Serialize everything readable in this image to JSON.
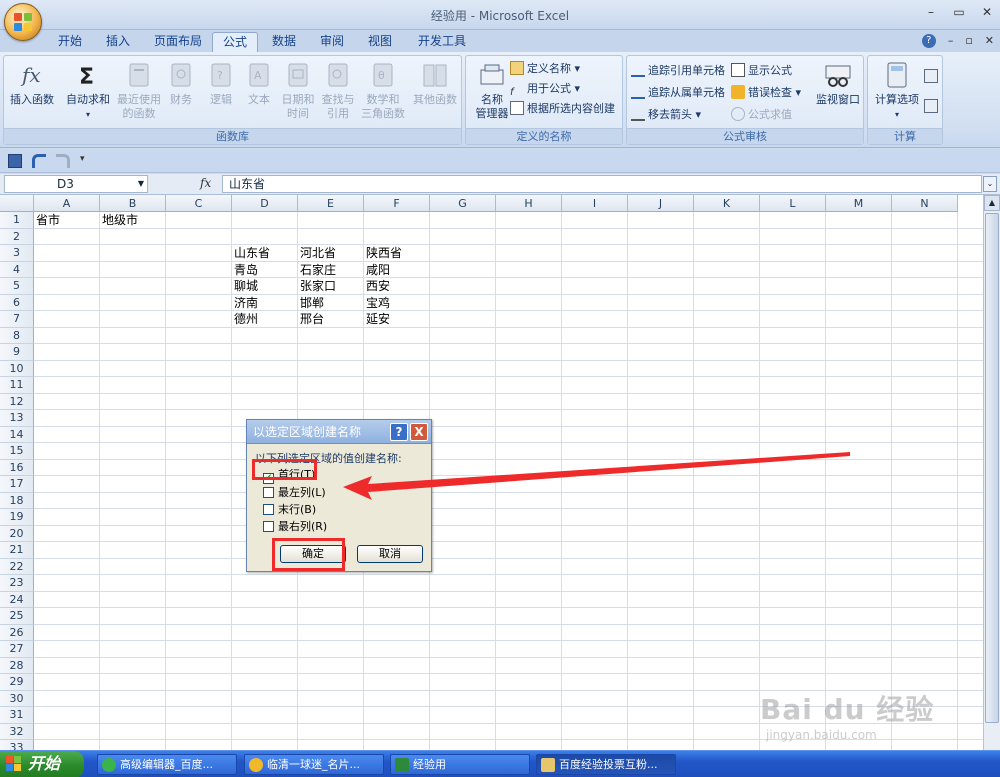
{
  "window": {
    "title": "经验用 - Microsoft Excel"
  },
  "tabs": [
    {
      "label": "开始"
    },
    {
      "label": "插入"
    },
    {
      "label": "页面布局"
    },
    {
      "label": "公式"
    },
    {
      "label": "数据"
    },
    {
      "label": "审阅"
    },
    {
      "label": "视图"
    },
    {
      "label": "开发工具"
    }
  ],
  "active_tab": "公式",
  "ribbon": {
    "library": {
      "label": "函数库",
      "insert_function": "插入函数",
      "autosum": "自动求和",
      "recent_1": "最近使用",
      "recent_2": "的函数",
      "financial": "财务",
      "logical": "逻辑",
      "text": "文本",
      "datetime_1": "日期和",
      "datetime_2": "时间",
      "lookup_1": "查找与",
      "lookup_2": "引用",
      "math_1": "数学和",
      "math_2": "三角函数",
      "more": "其他函数"
    },
    "names": {
      "label": "定义的名称",
      "manager_1": "名称",
      "manager_2": "管理器",
      "define": "定义名称",
      "use_in_formula": "用于公式",
      "create_from_selection": "根据所选内容创建"
    },
    "audit": {
      "label": "公式审核",
      "trace_precedents": "追踪引用单元格",
      "trace_dependents": "追踪从属单元格",
      "remove_arrows": "移去箭头",
      "show_formulas": "显示公式",
      "error_check": "错误检查",
      "evaluate": "公式求值",
      "watch": "监视窗口"
    },
    "calc": {
      "label": "计算",
      "options": "计算选项"
    }
  },
  "formula_bar": {
    "name_box": "D3",
    "fx": "fx",
    "value": "山东省"
  },
  "grid": {
    "columns": [
      "A",
      "B",
      "C",
      "D",
      "E",
      "F",
      "G",
      "H",
      "I",
      "J",
      "K",
      "L",
      "M",
      "N"
    ],
    "rows": [
      "1",
      "2",
      "3",
      "4",
      "5",
      "6",
      "7",
      "8",
      "9",
      "10",
      "11",
      "12",
      "13",
      "14",
      "15",
      "16",
      "17",
      "18",
      "19",
      "20",
      "21",
      "22",
      "23",
      "24",
      "25",
      "26",
      "27",
      "28",
      "29",
      "30",
      "31",
      "32",
      "33"
    ],
    "cells": {
      "A1": "省市",
      "B1": "地级市",
      "D3": "山东省",
      "E3": "河北省",
      "F3": "陕西省",
      "D4": "青岛",
      "E4": "石家庄",
      "F4": "咸阳",
      "D5": "聊城",
      "E5": "张家口",
      "F5": "西安",
      "D6": "济南",
      "E6": "邯郸",
      "F6": "宝鸡",
      "D7": "德州",
      "E7": "邢台",
      "F7": "延安"
    }
  },
  "dialog": {
    "title": "以选定区域创建名称",
    "prompt": "以下列选定区域的值创建名称:",
    "options": [
      {
        "label": "首行(T)",
        "checked": true
      },
      {
        "label": "最左列(L)",
        "checked": false
      },
      {
        "label": "末行(B)",
        "checked": false
      },
      {
        "label": "最右列(R)",
        "checked": false
      }
    ],
    "ok": "确定",
    "cancel": "取消",
    "help": "?",
    "close": "X"
  },
  "taskbar": {
    "start": "开始",
    "tasks": [
      {
        "label": "高级编辑器_百度..."
      },
      {
        "label": "临清一球迷_名片..."
      },
      {
        "label": "经验用"
      },
      {
        "label": "百度经验投票互粉..."
      }
    ]
  },
  "watermark": {
    "brand": "Bai du 经验",
    "url": "jingyan.baidu.com"
  },
  "colors": {
    "annotation": "#ee2a2a",
    "ribbon_text": "#15428b",
    "taskbar": "#2257c8",
    "start": "#2b8b2b"
  }
}
